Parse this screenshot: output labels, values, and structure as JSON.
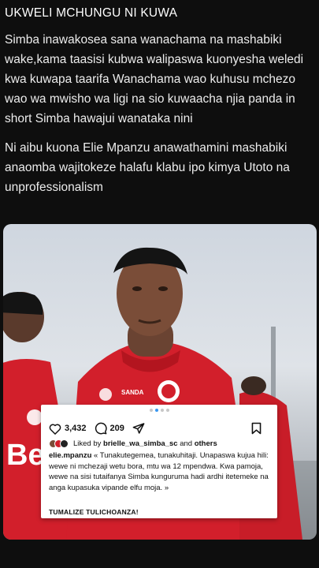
{
  "post": {
    "headline": "UKWELI MCHUNGU NI KUWA",
    "paragraph_1": "Simba inawakosea sana wanachama na mashabiki wake,kama taasisi kubwa  walipaswa kuonyesha weledi kwa kuwapa taarifa Wanachama wao kuhusu mchezo wao wa mwisho wa ligi na sio kuwaacha njia panda in short Simba hawajui wanataka nini",
    "paragraph_2": "Ni aibu kuona Elie Mpanzu anawathamini mashabiki anaomba wajitokeze halafu klabu ipo kimya Utoto na unprofessionalism"
  },
  "photo": {
    "jersey_print": "SANDA",
    "sponsor_text": "Bet"
  },
  "instagram": {
    "likes_count": "3,432",
    "comments_count": "209",
    "liked_by_prefix": "Liked by",
    "liked_by_user": "brielle_wa_simba_sc",
    "liked_by_and": "and",
    "liked_by_others": "others",
    "caption_user": "elie.mpanzu",
    "caption_text": "« Tunakutegemea, tunakuhitaji. Unapaswa kujua hili: wewe ni mchezaji wetu bora, mtu wa 12 mpendwa. Kwa pamoja, wewe na sisi tutaifanya Simba kunguruma hadi ardhi itetemeke na anga kupasuka vipande elfu moja. »",
    "tagline": "TUMALIZE TULICHOANZA!",
    "icons": [
      "heart-icon",
      "comment-icon",
      "share-icon",
      "bookmark-icon"
    ],
    "accent_color": "#3897f0"
  },
  "colors": {
    "background": "#0e0e0e",
    "jersey_red": "#d21f2b"
  }
}
